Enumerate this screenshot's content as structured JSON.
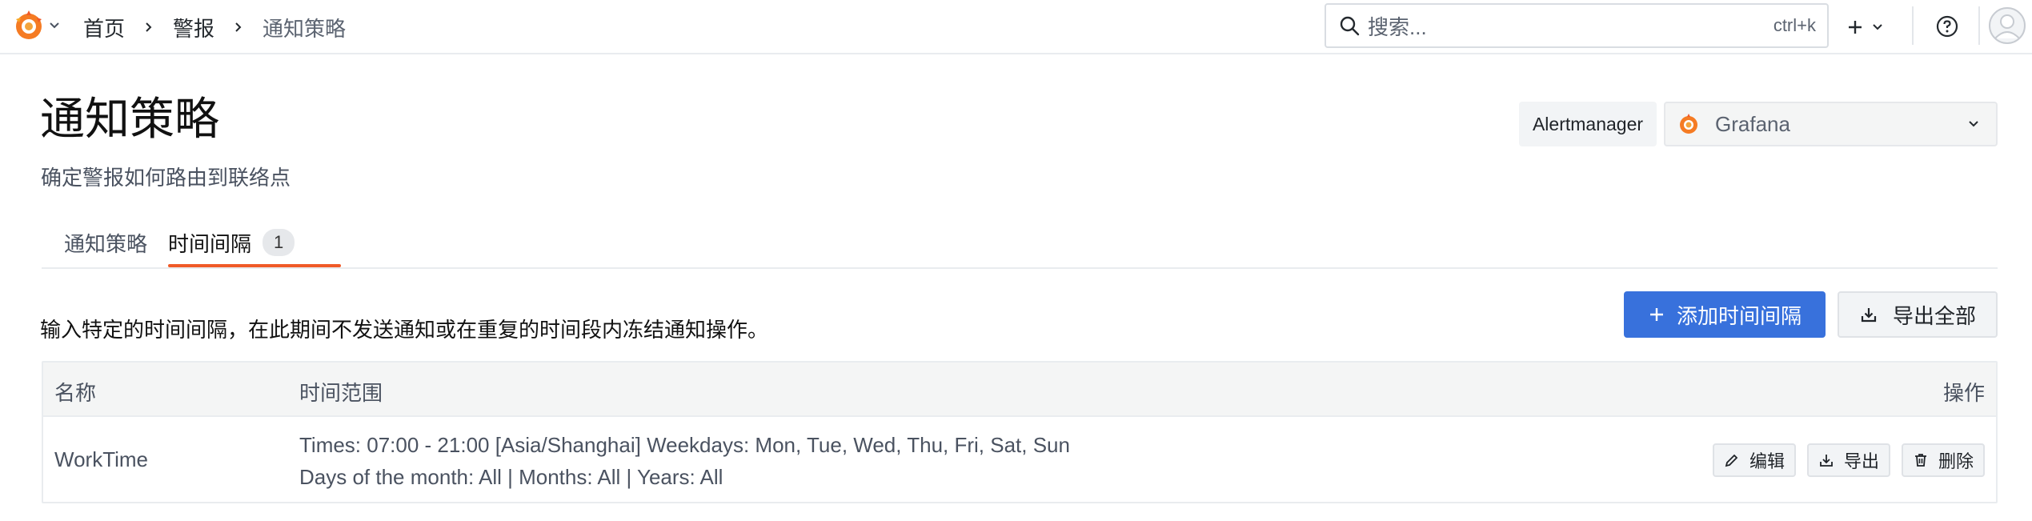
{
  "topbar": {
    "breadcrumbs": [
      "首页",
      "警报",
      "通知策略"
    ],
    "search": {
      "placeholder": "搜索...",
      "shortcut": "ctrl+k"
    }
  },
  "header": {
    "title": "通知策略",
    "subtitle": "确定警报如何路由到联络点",
    "alertmanager_label": "Alertmanager",
    "alertmanager_value": "Grafana"
  },
  "tabs": [
    {
      "label": "通知策略",
      "active": false
    },
    {
      "label": "时间间隔",
      "active": true,
      "count": "1"
    }
  ],
  "description": "输入特定的时间间隔，在此期间不发送通知或在重复的时间段内冻结通知操作。",
  "buttons": {
    "add": "添加时间间隔",
    "export_all": "导出全部"
  },
  "table": {
    "columns": [
      "名称",
      "时间范围",
      "操作"
    ],
    "rows": [
      {
        "name": "WorkTime",
        "range_line1": "Times: 07:00 - 21:00 [Asia/Shanghai] Weekdays: Mon, Tue, Wed, Thu, Fri, Sat, Sun",
        "range_line2": "Days of the month: All | Months: All | Years: All",
        "actions": {
          "edit": "编辑",
          "export": "导出",
          "delete": "删除"
        }
      }
    ]
  },
  "colors": {
    "primary": "#3871dc",
    "tab_active_underline": "#f05a28",
    "brand_orange": "#f05a28"
  },
  "icons": [
    "grafana-logo-icon",
    "chevron-down-icon",
    "chevron-right-icon",
    "search-icon",
    "plus-icon",
    "help-icon",
    "user-avatar-icon",
    "download-icon",
    "edit-icon",
    "trash-icon"
  ]
}
